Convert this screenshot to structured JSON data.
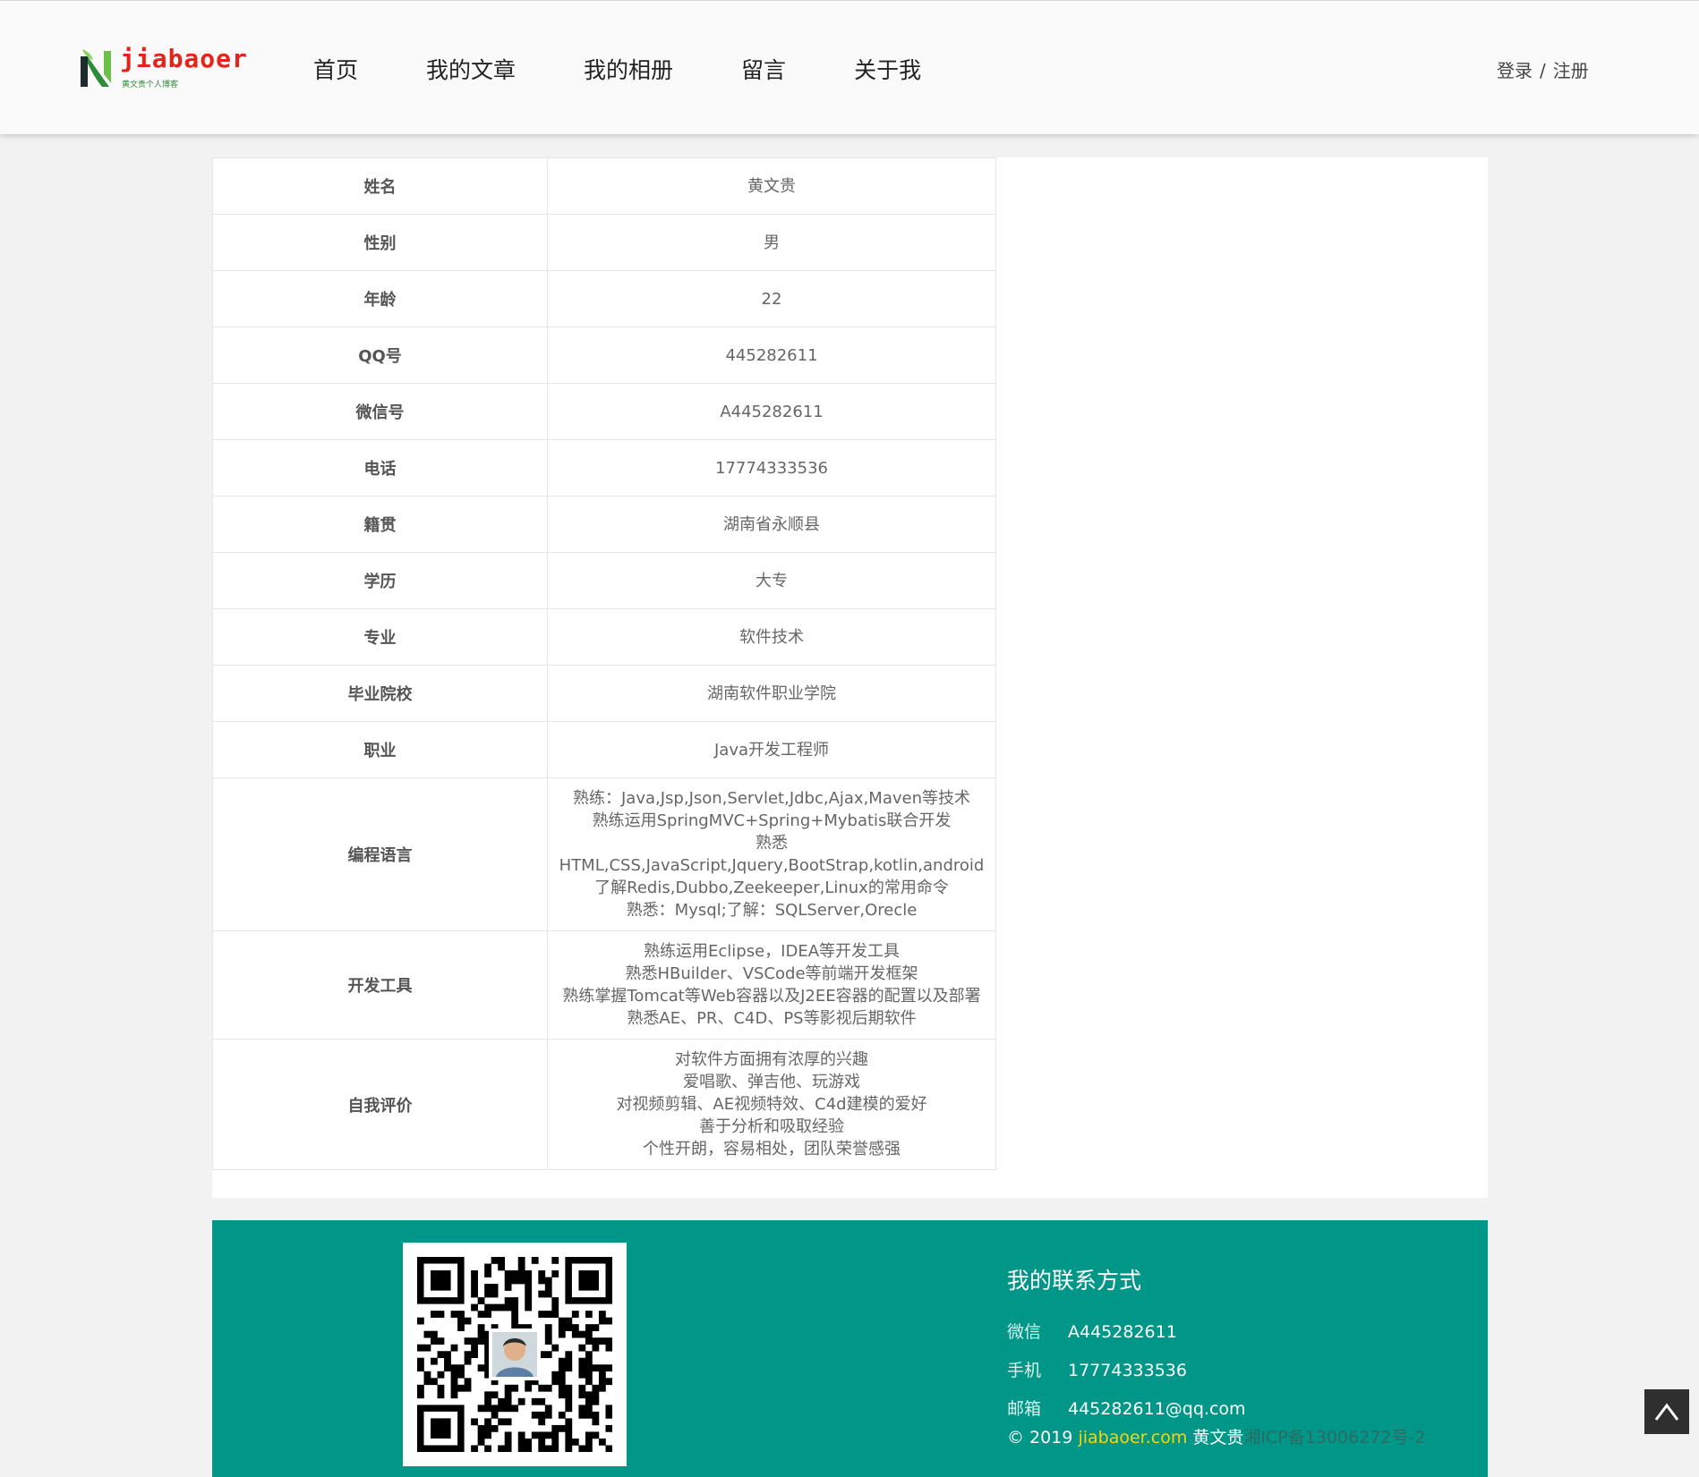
{
  "header": {
    "logo_text": "jiabaoer",
    "logo_sub": "黄文贵个人博客",
    "nav": [
      "首页",
      "我的文章",
      "我的相册",
      "留言",
      "关于我"
    ],
    "login": "登录",
    "auth_sep": "/",
    "register": "注册"
  },
  "profile": [
    {
      "label": "姓名",
      "value": "黄文贵"
    },
    {
      "label": "性别",
      "value": "男"
    },
    {
      "label": "年龄",
      "value": "22"
    },
    {
      "label": "QQ号",
      "value": "445282611"
    },
    {
      "label": "微信号",
      "value": "A445282611"
    },
    {
      "label": "电话",
      "value": "17774333536"
    },
    {
      "label": "籍贯",
      "value": "湖南省永顺县"
    },
    {
      "label": "学历",
      "value": "大专"
    },
    {
      "label": "专业",
      "value": "软件技术"
    },
    {
      "label": "毕业院校",
      "value": "湖南软件职业学院"
    },
    {
      "label": "职业",
      "value": "Java开发工程师"
    },
    {
      "label": "编程语言",
      "lines": [
        "熟练：Java,Jsp,Json,Servlet,Jdbc,Ajax,Maven等技术",
        "熟练运用SpringMVC+Spring+Mybatis联合开发",
        "熟悉HTML,CSS,JavaScript,Jquery,BootStrap,kotlin,android",
        "了解Redis,Dubbo,Zeekeeper,Linux的常用命令",
        "熟悉：Mysql;了解：SQLServer,Orecle"
      ]
    },
    {
      "label": "开发工具",
      "lines": [
        "熟练运用Eclipse，IDEA等开发工具",
        "熟悉HBuilder、VSCode等前端开发框架",
        "熟练掌握Tomcat等Web容器以及J2EE容器的配置以及部署",
        "熟悉AE、PR、C4D、PS等影视后期软件"
      ]
    },
    {
      "label": "自我评价",
      "lines": [
        "对软件方面拥有浓厚的兴趣",
        "爱唱歌、弹吉他、玩游戏",
        "对视频剪辑、AE视频特效、C4d建模的爱好",
        "善于分析和吸取经验",
        "个性开朗，容易相处，团队荣誉感强"
      ]
    }
  ],
  "footer": {
    "contact_title": "我的联系方式",
    "wechat_label": "微信",
    "wechat": "A445282611",
    "phone_label": "手机",
    "phone": "17774333536",
    "email_label": "邮箱",
    "email": "445282611@qq.com",
    "copyright_prefix": "© 2019",
    "site": "jiabaoer.com",
    "author": "黄文贵",
    "icp": "湘ICP备13006272号-2"
  },
  "icons": {
    "logo": "logo-icon",
    "qr": "qr-code-icon",
    "to_top": "arrow-up-icon"
  },
  "colors": {
    "footer": "#009688",
    "logo_red": "#e5231b",
    "logo_green": "#2d8c38",
    "site_link": "#ffd400"
  }
}
